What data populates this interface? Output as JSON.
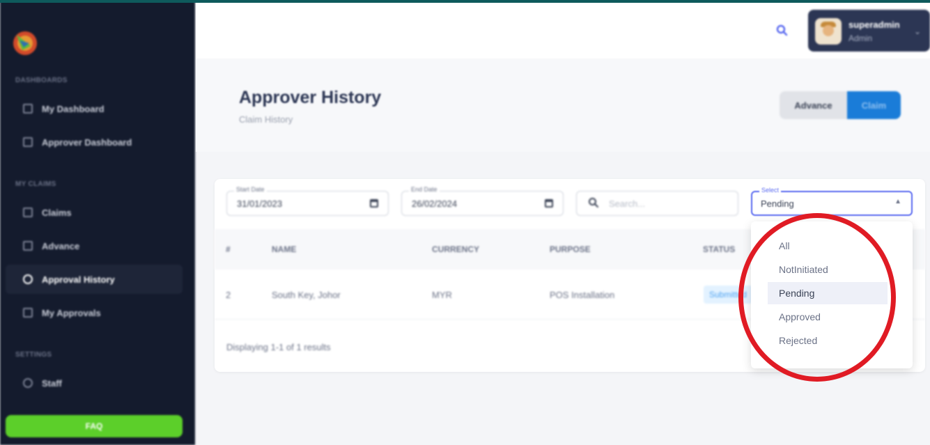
{
  "sidebar": {
    "sections": [
      {
        "heading": "DASHBOARDS",
        "items": [
          "My Dashboard",
          "Approver Dashboard"
        ]
      },
      {
        "heading": "MY CLAIMS",
        "items": [
          "Claims",
          "Advance",
          "Approval History",
          "My Approvals"
        ]
      },
      {
        "heading": "SETTINGS",
        "items": [
          "Staff"
        ]
      }
    ],
    "active_item": "Approval History",
    "faq_label": "FAQ"
  },
  "header": {
    "user": {
      "name": "superadmin",
      "role": "Admin"
    }
  },
  "page": {
    "title": "Approver History",
    "subtitle": "Claim History",
    "toggle": {
      "advance": "Advance",
      "claim": "Claim"
    }
  },
  "filters": {
    "start_date": {
      "label": "Start Date",
      "value": "31/01/2023"
    },
    "end_date": {
      "label": "End Date",
      "value": "26/02/2024"
    },
    "search_placeholder": "Search...",
    "select": {
      "label": "Select",
      "value": "Pending",
      "options": [
        "All",
        "NotInitiated",
        "Pending",
        "Approved",
        "Rejected"
      ]
    }
  },
  "table": {
    "columns": [
      "#",
      "NAME",
      "CURRENCY",
      "PURPOSE",
      "STATUS"
    ],
    "rows": [
      {
        "num": "2",
        "name": "South Key, Johor",
        "currency": "MYR",
        "purpose": "POS Installation",
        "status": "Submitted"
      }
    ],
    "footer": "Displaying 1-1 of 1 results"
  },
  "colors": {
    "sidebar_bg": "#141b2d",
    "accent": "#5b6bf0",
    "primary": "#1a7cd8",
    "faq": "#5ccf2a",
    "highlight_circle": "#e01b24"
  }
}
